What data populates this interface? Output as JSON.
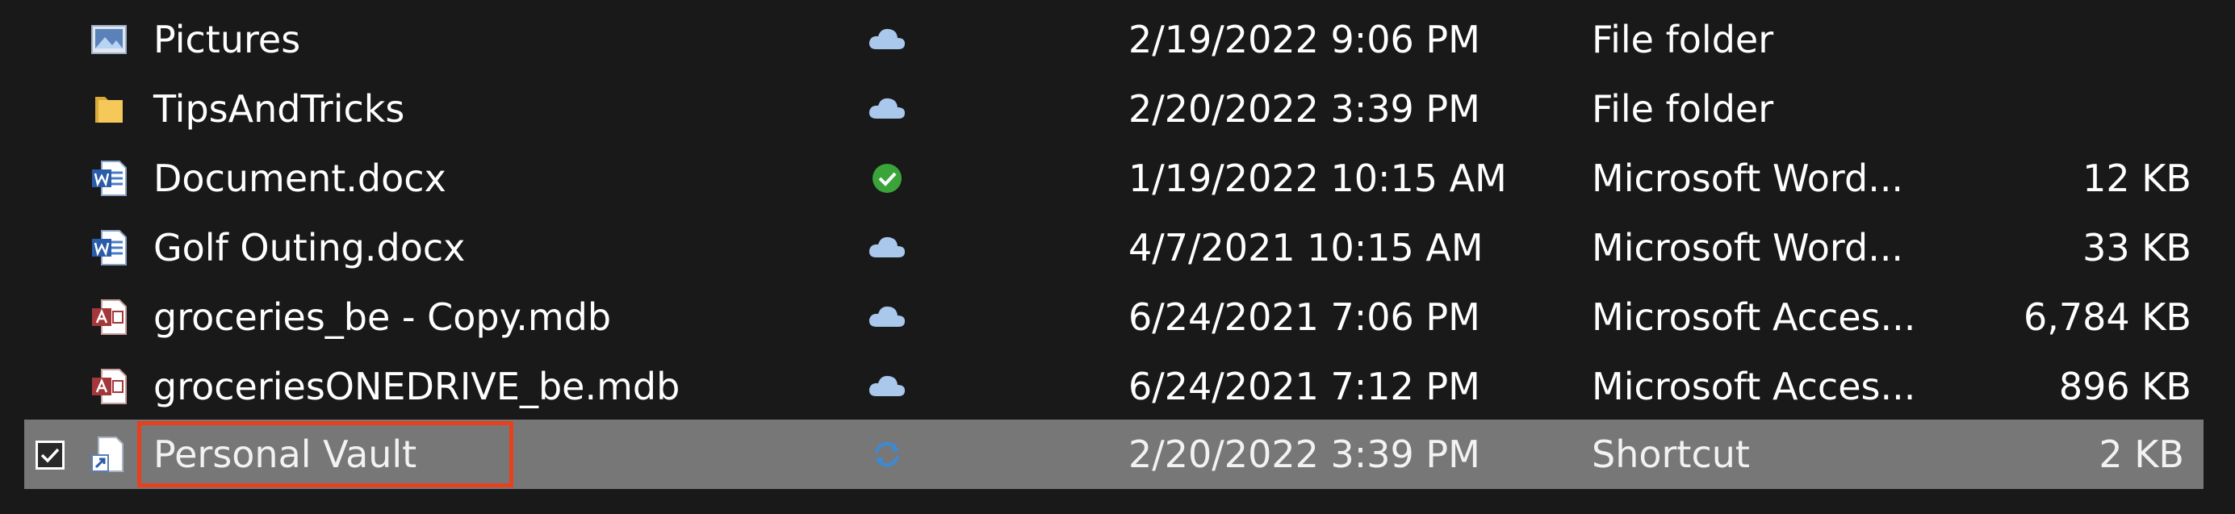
{
  "colors": {
    "background": "#191919",
    "selected_row": "#777777",
    "highlight_box": "#e8401c",
    "sync_cloud": "#a9c8ec",
    "sync_available": "#3aa43a"
  },
  "rows": [
    {
      "name": "Pictures",
      "icon": "pictures-folder-icon",
      "status": "cloud-icon",
      "date": "2/19/2022 9:06 PM",
      "type": "File folder",
      "size": ""
    },
    {
      "name": "TipsAndTricks",
      "icon": "folder-icon",
      "status": "cloud-icon",
      "date": "2/20/2022 3:39 PM",
      "type": "File folder",
      "size": ""
    },
    {
      "name": "Document.docx",
      "icon": "word-doc-icon",
      "status": "available-check-icon",
      "date": "1/19/2022 10:15 AM",
      "type": "Microsoft Word...",
      "size": "12 KB"
    },
    {
      "name": "Golf Outing.docx",
      "icon": "word-doc-icon",
      "status": "cloud-icon",
      "date": "4/7/2021 10:15 AM",
      "type": "Microsoft Word...",
      "size": "33 KB"
    },
    {
      "name": "groceries_be - Copy.mdb",
      "icon": "access-db-icon",
      "status": "cloud-icon",
      "date": "6/24/2021 7:06 PM",
      "type": "Microsoft Acces...",
      "size": "6,784 KB"
    },
    {
      "name": "groceriesONEDRIVE_be.mdb",
      "icon": "access-db-icon",
      "status": "cloud-icon",
      "date": "6/24/2021 7:12 PM",
      "type": "Microsoft Acces...",
      "size": "896 KB"
    },
    {
      "name": "Personal Vault",
      "icon": "shortcut-icon",
      "status": "sync-icon",
      "date": "2/20/2022 3:39 PM",
      "type": "Shortcut",
      "size": "2 KB",
      "selected": true,
      "checked": true
    }
  ]
}
